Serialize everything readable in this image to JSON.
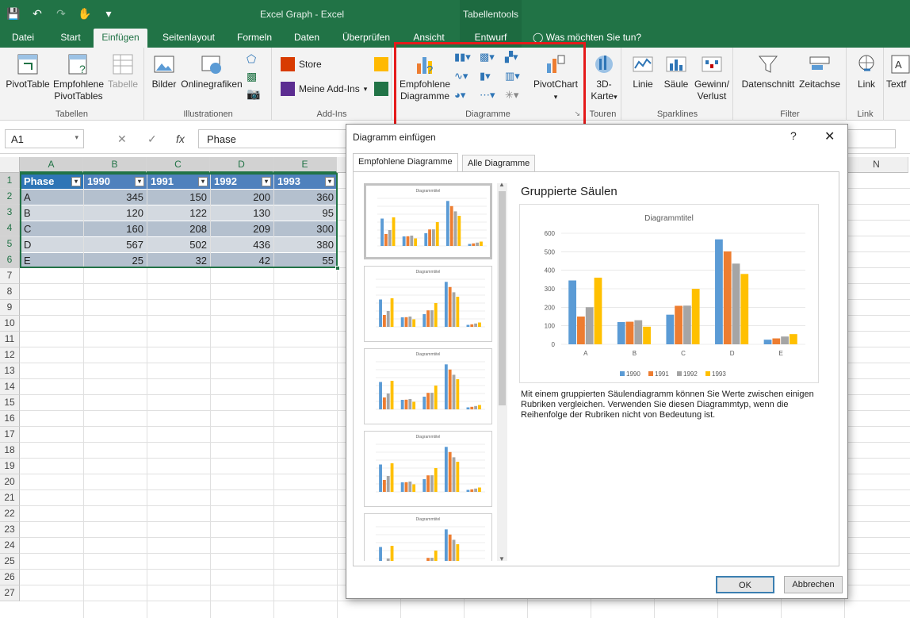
{
  "window": {
    "title": "Excel Graph - Excel",
    "context_group": "Tabellentools"
  },
  "tabs": [
    {
      "label": "Datei"
    },
    {
      "label": "Start"
    },
    {
      "label": "Einfügen"
    },
    {
      "label": "Seitenlayout"
    },
    {
      "label": "Formeln"
    },
    {
      "label": "Daten"
    },
    {
      "label": "Überprüfen"
    },
    {
      "label": "Ansicht"
    },
    {
      "label": "Entwurf"
    },
    {
      "label": "Was möchten Sie tun?"
    }
  ],
  "ribbon": {
    "tabellen": {
      "label": "Tabellen",
      "pivottable": "PivotTable",
      "empf_pivot_1": "Empfohlene",
      "empf_pivot_2": "PivotTables",
      "tabelle": "Tabelle"
    },
    "illustrationen": {
      "label": "Illustrationen",
      "bilder": "Bilder",
      "online": "Onlinegrafiken"
    },
    "addins": {
      "label": "Add-Ins",
      "store": "Store",
      "meine": "Meine Add-Ins"
    },
    "diagramme": {
      "label": "Diagramme",
      "empf_1": "Empfohlene",
      "empf_2": "Diagramme",
      "pivotchart": "PivotChart"
    },
    "touren": {
      "label": "Touren",
      "karte_1": "3D-",
      "karte_2": "Karte"
    },
    "sparklines": {
      "label": "Sparklines",
      "linie": "Linie",
      "saeule": "Säule",
      "gv_1": "Gewinn/",
      "gv_2": "Verlust"
    },
    "filter": {
      "label": "Filter",
      "datenschnitt": "Datenschnitt",
      "zeitachse": "Zeitachse"
    },
    "link": {
      "label": "Link",
      "link": "Link"
    },
    "text": {
      "label": "Textf"
    }
  },
  "formula_bar": {
    "name_box": "A1",
    "fx": "fx",
    "content": "Phase"
  },
  "sheet": {
    "columns": [
      "A",
      "B",
      "C",
      "D",
      "E",
      "N"
    ],
    "rows": [
      "1",
      "2",
      "3",
      "4",
      "5",
      "6",
      "7",
      "8",
      "9",
      "10",
      "11",
      "12",
      "13",
      "14",
      "15",
      "16",
      "17",
      "18",
      "19",
      "20",
      "21",
      "22",
      "23",
      "24",
      "25",
      "26",
      "27"
    ],
    "table": {
      "headers": [
        "Phase",
        "1990",
        "1991",
        "1992",
        "1993"
      ],
      "data": [
        [
          "A",
          "345",
          "150",
          "200",
          "360"
        ],
        [
          "B",
          "120",
          "122",
          "130",
          "95"
        ],
        [
          "C",
          "160",
          "208",
          "209",
          "300"
        ],
        [
          "D",
          "567",
          "502",
          "436",
          "380"
        ],
        [
          "E",
          "25",
          "32",
          "42",
          "55"
        ]
      ]
    }
  },
  "dialog": {
    "title": "Diagramm einfügen",
    "help": "?",
    "close": "✕",
    "tabs": [
      "Empfohlene Diagramme",
      "Alle Diagramme"
    ],
    "thumb_title": "Diagrammtitel",
    "preview_heading": "Gruppierte Säulen",
    "description": "Mit einem gruppierten Säulendiagramm können Sie Werte zwischen einigen Rubriken vergleichen. Verwenden Sie diesen Diagrammtyp, wenn die Reihenfolge der Rubriken nicht von Bedeutung ist.",
    "ok": "OK",
    "cancel": "Abbrechen"
  },
  "chart_data": {
    "type": "bar",
    "title": "Diagrammtitel",
    "categories": [
      "A",
      "B",
      "C",
      "D",
      "E"
    ],
    "series": [
      {
        "name": "1990",
        "values": [
          345,
          120,
          160,
          567,
          25
        ],
        "color": "#5b9bd5"
      },
      {
        "name": "1991",
        "values": [
          150,
          122,
          208,
          502,
          32
        ],
        "color": "#ed7d31"
      },
      {
        "name": "1992",
        "values": [
          200,
          130,
          209,
          436,
          42
        ],
        "color": "#a5a5a5"
      },
      {
        "name": "1993",
        "values": [
          360,
          95,
          300,
          380,
          55
        ],
        "color": "#ffc000"
      }
    ],
    "ylim": [
      0,
      600
    ],
    "yticks": [
      "0",
      "100",
      "200",
      "300",
      "400",
      "500",
      "600"
    ],
    "legend": "bottom",
    "grid": true
  },
  "colors": {
    "excel_green": "#217346",
    "table_header": "#4f81bd",
    "highlight": "#e51a1a"
  }
}
